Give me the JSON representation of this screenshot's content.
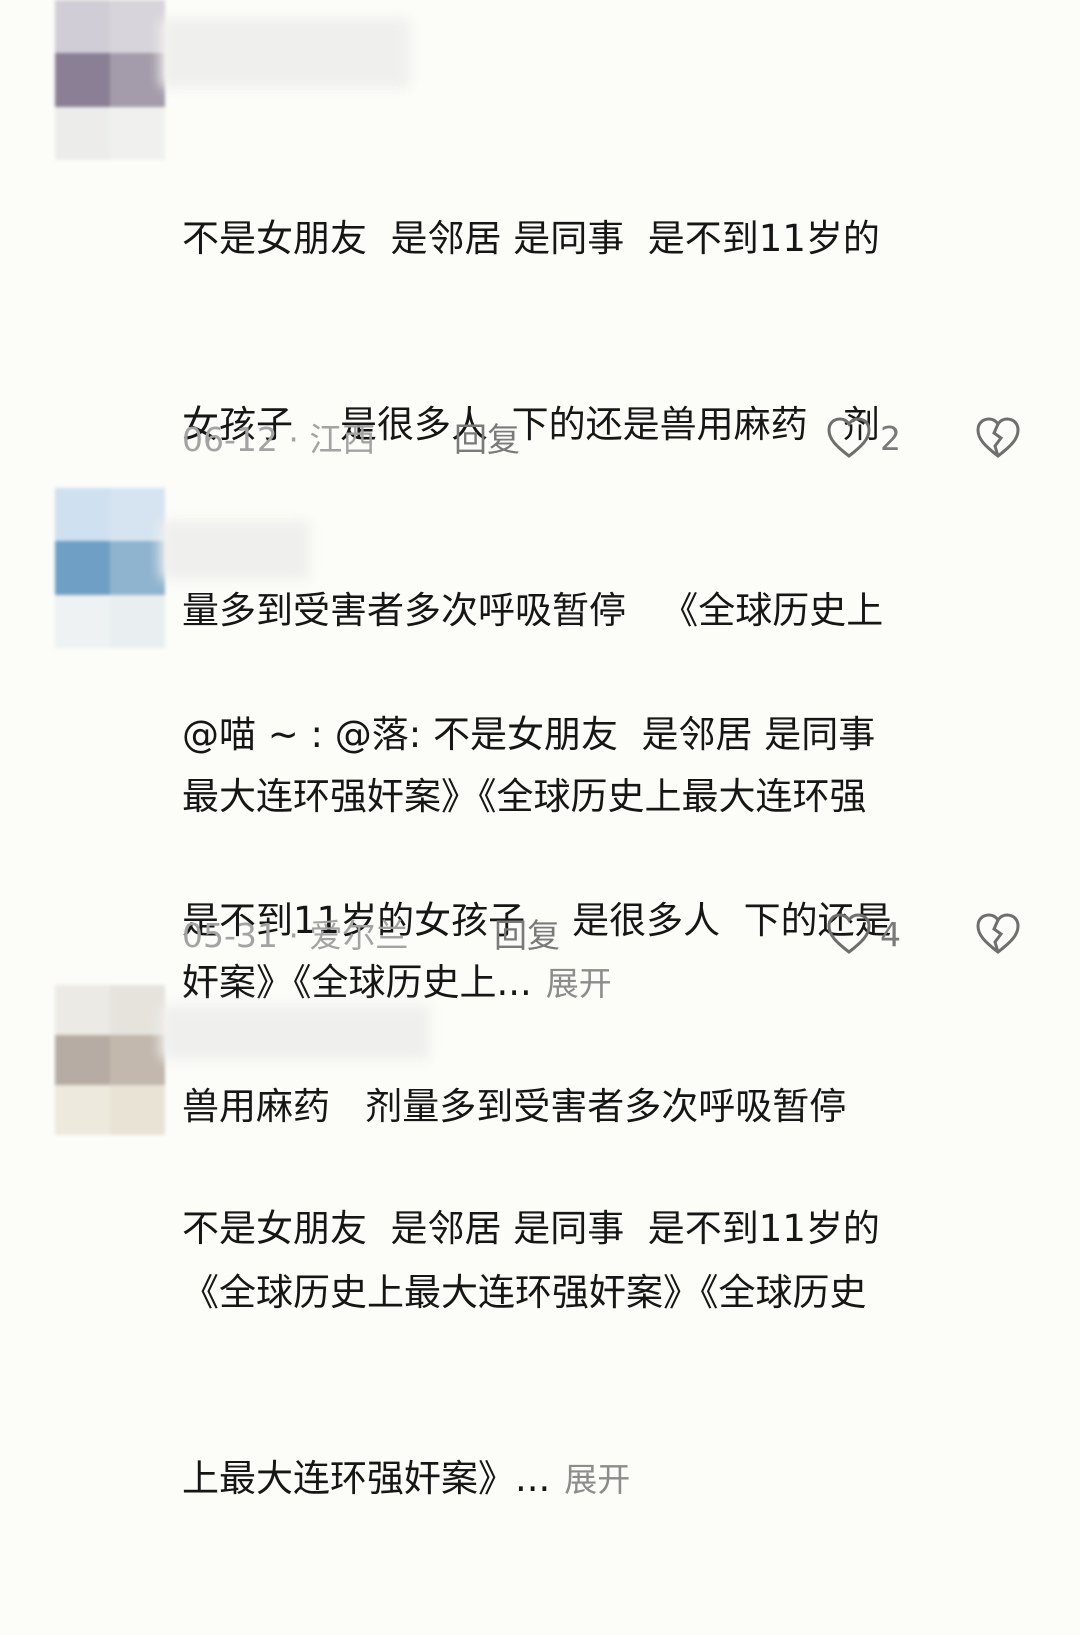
{
  "comments": [
    {
      "text": "不是女朋友  是邻居 是同事  是不到11岁的女孩子    是很多人  下的还是兽用麻药   剂量多到受害者多次呼吸暂停   《全球历史上最大连环强奸案》《全球历史上最大连环强奸案》《全球历史上...",
      "lines": [
        "不是女朋友  是邻居 是同事  是不到11岁的",
        "女孩子    是很多人  下的还是兽用麻药   剂",
        "量多到受害者多次呼吸暂停   《全球历史上",
        "最大连环强奸案》《全球历史上最大连环强",
        "奸案》《全球历史上..."
      ],
      "expand_label": "展开",
      "date": "06-12",
      "separator": "·",
      "location": "江西",
      "reply_label": "回复",
      "like_count": "2"
    },
    {
      "lines": [
        "@喵 ~ : @落: 不是女朋友  是邻居 是同事",
        "是不到11岁的女孩子    是很多人  下的还是",
        "兽用麻药   剂量多到受害者多次呼吸暂停",
        "《全球历史上最大连环强奸案》《全球历史",
        "上最大连环强奸案》..."
      ],
      "expand_label": "展开",
      "date": "05-31",
      "separator": "·",
      "location": "爱尔兰",
      "reply_label": "回复",
      "like_count": "4"
    },
    {
      "lines": [
        "不是女朋友  是邻居 是同事  是不到11岁的"
      ]
    }
  ],
  "icons": {
    "like": "heart-outline-icon",
    "dislike": "broken-heart-icon"
  },
  "colors": {
    "text": "#161616",
    "meta": "#a3a3a3",
    "action": "#7a7a7a"
  }
}
